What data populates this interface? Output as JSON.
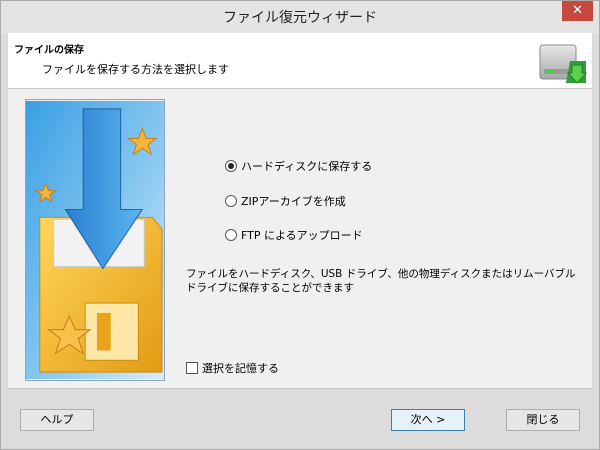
{
  "window": {
    "title": "ファイル復元ウィザード",
    "close_glyph": "✕"
  },
  "header": {
    "title": "ファイルの保存",
    "subtitle": "ファイルを保存する方法を選択します"
  },
  "options": [
    {
      "label": "ハードディスクに保存する",
      "selected": true
    },
    {
      "label": "ZIPアーカイブを作成",
      "selected": false
    },
    {
      "label": "FTP によるアップロード",
      "selected": false
    }
  ],
  "description": "ファイルをハードディスク、USB ドライブ、他の物理ディスクまたはリムーバブルドライブに保存することができます",
  "remember": {
    "label": "選択を記憶する",
    "checked": false
  },
  "buttons": {
    "help": "ヘルプ",
    "next": "次へ >",
    "close": "閉じる"
  },
  "colors": {
    "accent_blue": "#2a8fd8",
    "floppy_yellow": "#f4b81c",
    "star_gold": "#f6b53a"
  }
}
